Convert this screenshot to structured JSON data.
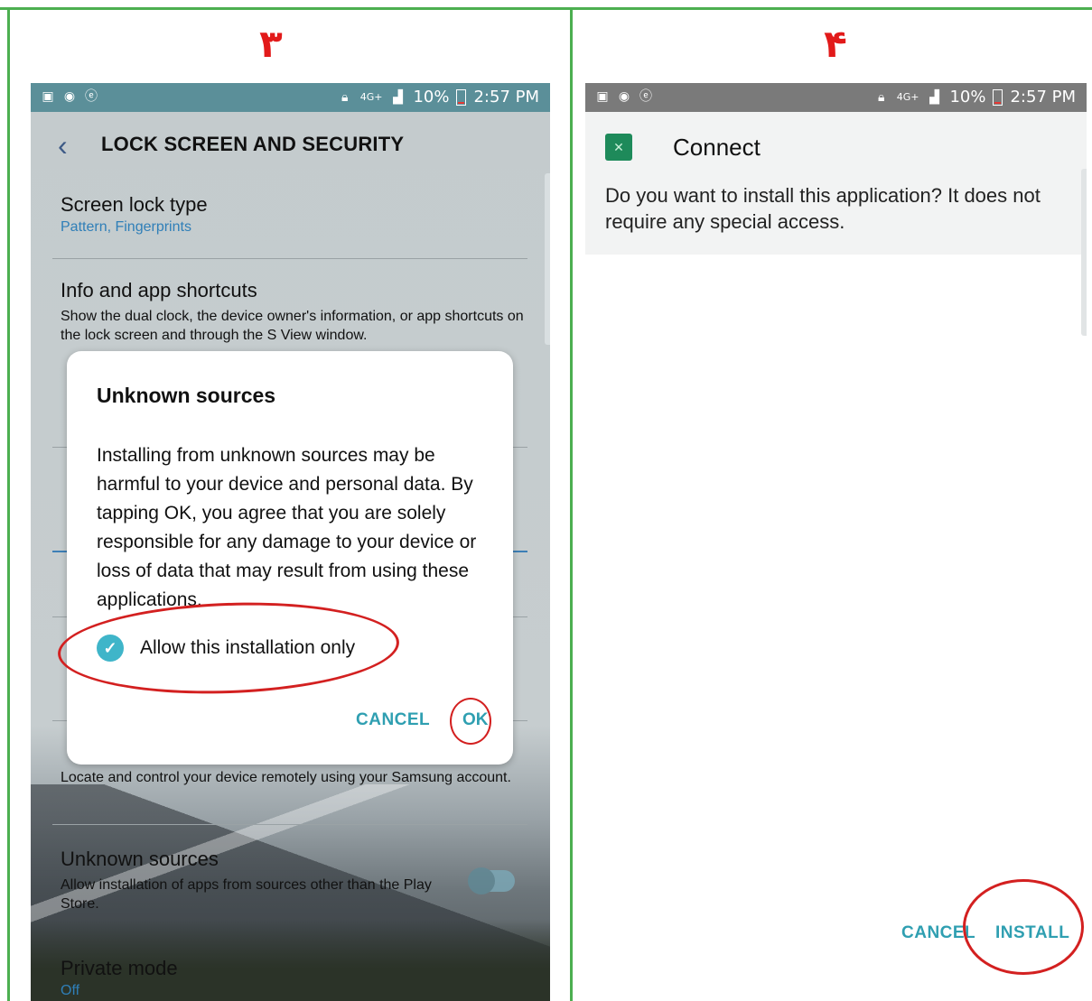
{
  "panels": {
    "left_number": "۳",
    "right_number": "۴"
  },
  "status_bar": {
    "network": "4G+",
    "battery": "10%",
    "time": "2:57 PM"
  },
  "left_screen": {
    "header_title": "LOCK SCREEN AND SECURITY",
    "settings": [
      {
        "title": "Screen lock type",
        "subtitle": "Pattern, Fingerprints"
      },
      {
        "title": "Info and app shortcuts",
        "description": "Show the dual clock, the device owner's information, or app shortcuts on the lock screen and through the S View window."
      },
      {
        "description": "Locate and control your device remotely using your Samsung account."
      },
      {
        "title": "Unknown sources",
        "description": "Allow installation of apps from sources other than the Play Store."
      },
      {
        "title": "Private mode",
        "subtitle": "Off"
      }
    ],
    "dialog": {
      "title": "Unknown sources",
      "body": "Installing from unknown sources may be harmful to your device and personal data. By tapping OK, you agree that you are solely responsible for any damage to your device or loss of data that may result from using these applications.",
      "checkbox_label": "Allow this installation only",
      "checkbox_checked": true,
      "cancel_label": "CANCEL",
      "ok_label": "OK"
    }
  },
  "right_screen": {
    "app_name": "Connect",
    "question": "Do you want to install this application? It does not require any special access.",
    "cancel_label": "CANCEL",
    "install_label": "INSTALL"
  },
  "colors": {
    "frame": "#4caf50",
    "panel_number": "#e21a1a",
    "annotation": "#d32020",
    "accent": "#2f9fb1",
    "status_bar_left": "#5b8f99",
    "status_bar_right": "#7a7a7a"
  }
}
